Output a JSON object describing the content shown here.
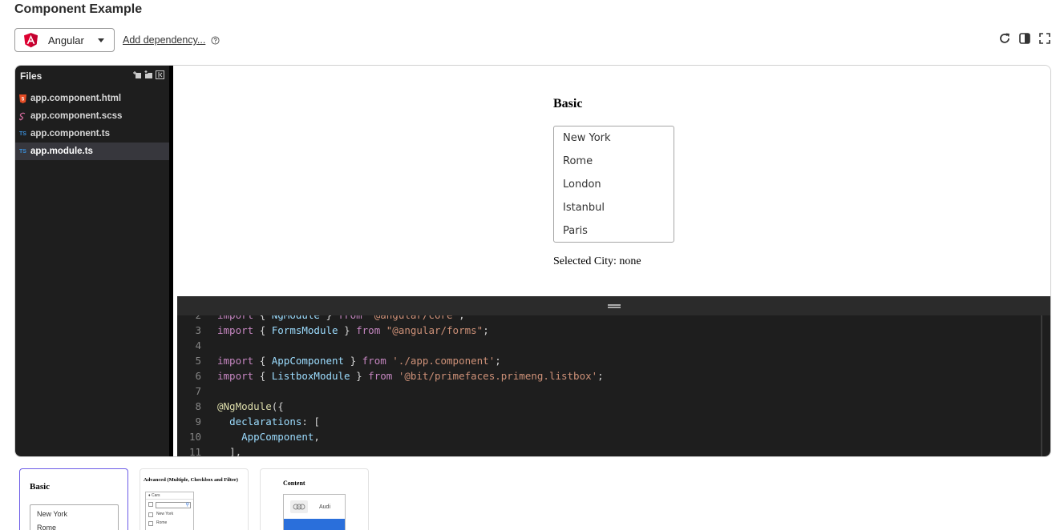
{
  "page": {
    "title": "Component Example"
  },
  "toolbar": {
    "framework": "Angular",
    "add_dependency": "Add dependency...",
    "icons": [
      "refresh-icon",
      "split-view-icon",
      "fullscreen-icon"
    ]
  },
  "files": {
    "header": "Files",
    "items": [
      {
        "name": "app.component.html",
        "type": "html"
      },
      {
        "name": "app.component.scss",
        "type": "scss"
      },
      {
        "name": "app.component.ts",
        "type": "ts"
      },
      {
        "name": "app.module.ts",
        "type": "ts",
        "active": true
      }
    ]
  },
  "preview": {
    "title": "Basic",
    "cities": [
      "New York",
      "Rome",
      "London",
      "Istanbul",
      "Paris"
    ],
    "selected_label": "Selected City: none"
  },
  "code": {
    "lines": [
      {
        "n": "2",
        "html": "<span class=\"kw\">import</span> <span class=\"pl\">{ </span><span class=\"id\">NgModule</span><span class=\"pl\"> } </span><span class=\"kw\">from</span> <span class=\"st\">'@angular/core'</span><span class=\"pl\">;</span>"
      },
      {
        "n": "3",
        "html": "<span class=\"kw\">import</span> <span class=\"pl\">{ </span><span class=\"id\">FormsModule</span><span class=\"pl\"> } </span><span class=\"kw\">from</span> <span class=\"st\">\"@angular/forms\"</span><span class=\"pl\">;</span>"
      },
      {
        "n": "4",
        "html": ""
      },
      {
        "n": "5",
        "html": "<span class=\"kw\">import</span> <span class=\"pl\">{ </span><span class=\"id\">AppComponent</span><span class=\"pl\"> } </span><span class=\"kw\">from</span> <span class=\"st\">'./app.component'</span><span class=\"pl\">;</span>"
      },
      {
        "n": "6",
        "html": "<span class=\"kw\">import</span> <span class=\"pl\">{ </span><span class=\"id\">ListboxModule</span><span class=\"pl\"> } </span><span class=\"kw\">from</span> <span class=\"st\">'@bit/primefaces.primeng.listbox'</span><span class=\"pl\">;</span>"
      },
      {
        "n": "7",
        "html": ""
      },
      {
        "n": "8",
        "html": "<span class=\"dc\">@NgModule</span><span class=\"pl\">({</span>"
      },
      {
        "n": "9",
        "html": "  <span class=\"id\">declarations</span><span class=\"pl\">: [</span>"
      },
      {
        "n": "10",
        "html": "    <span class=\"id\">AppComponent</span><span class=\"pl\">,</span>"
      },
      {
        "n": "11",
        "html": "  <span class=\"pl\">],</span>"
      }
    ]
  },
  "examples": [
    {
      "title": "Basic",
      "items": [
        "New York",
        "Rome"
      ],
      "active": true
    },
    {
      "title": "Advanced (Multiple, Checkbox and Filter)",
      "group": "Cars",
      "items": [
        "New York",
        "Rome"
      ]
    },
    {
      "title": "Content",
      "items": [
        "Audi"
      ]
    }
  ],
  "colors": {
    "accent": "#6c5ce7",
    "angular": "#dd0031",
    "editor_bg": "#1e1e1e"
  }
}
